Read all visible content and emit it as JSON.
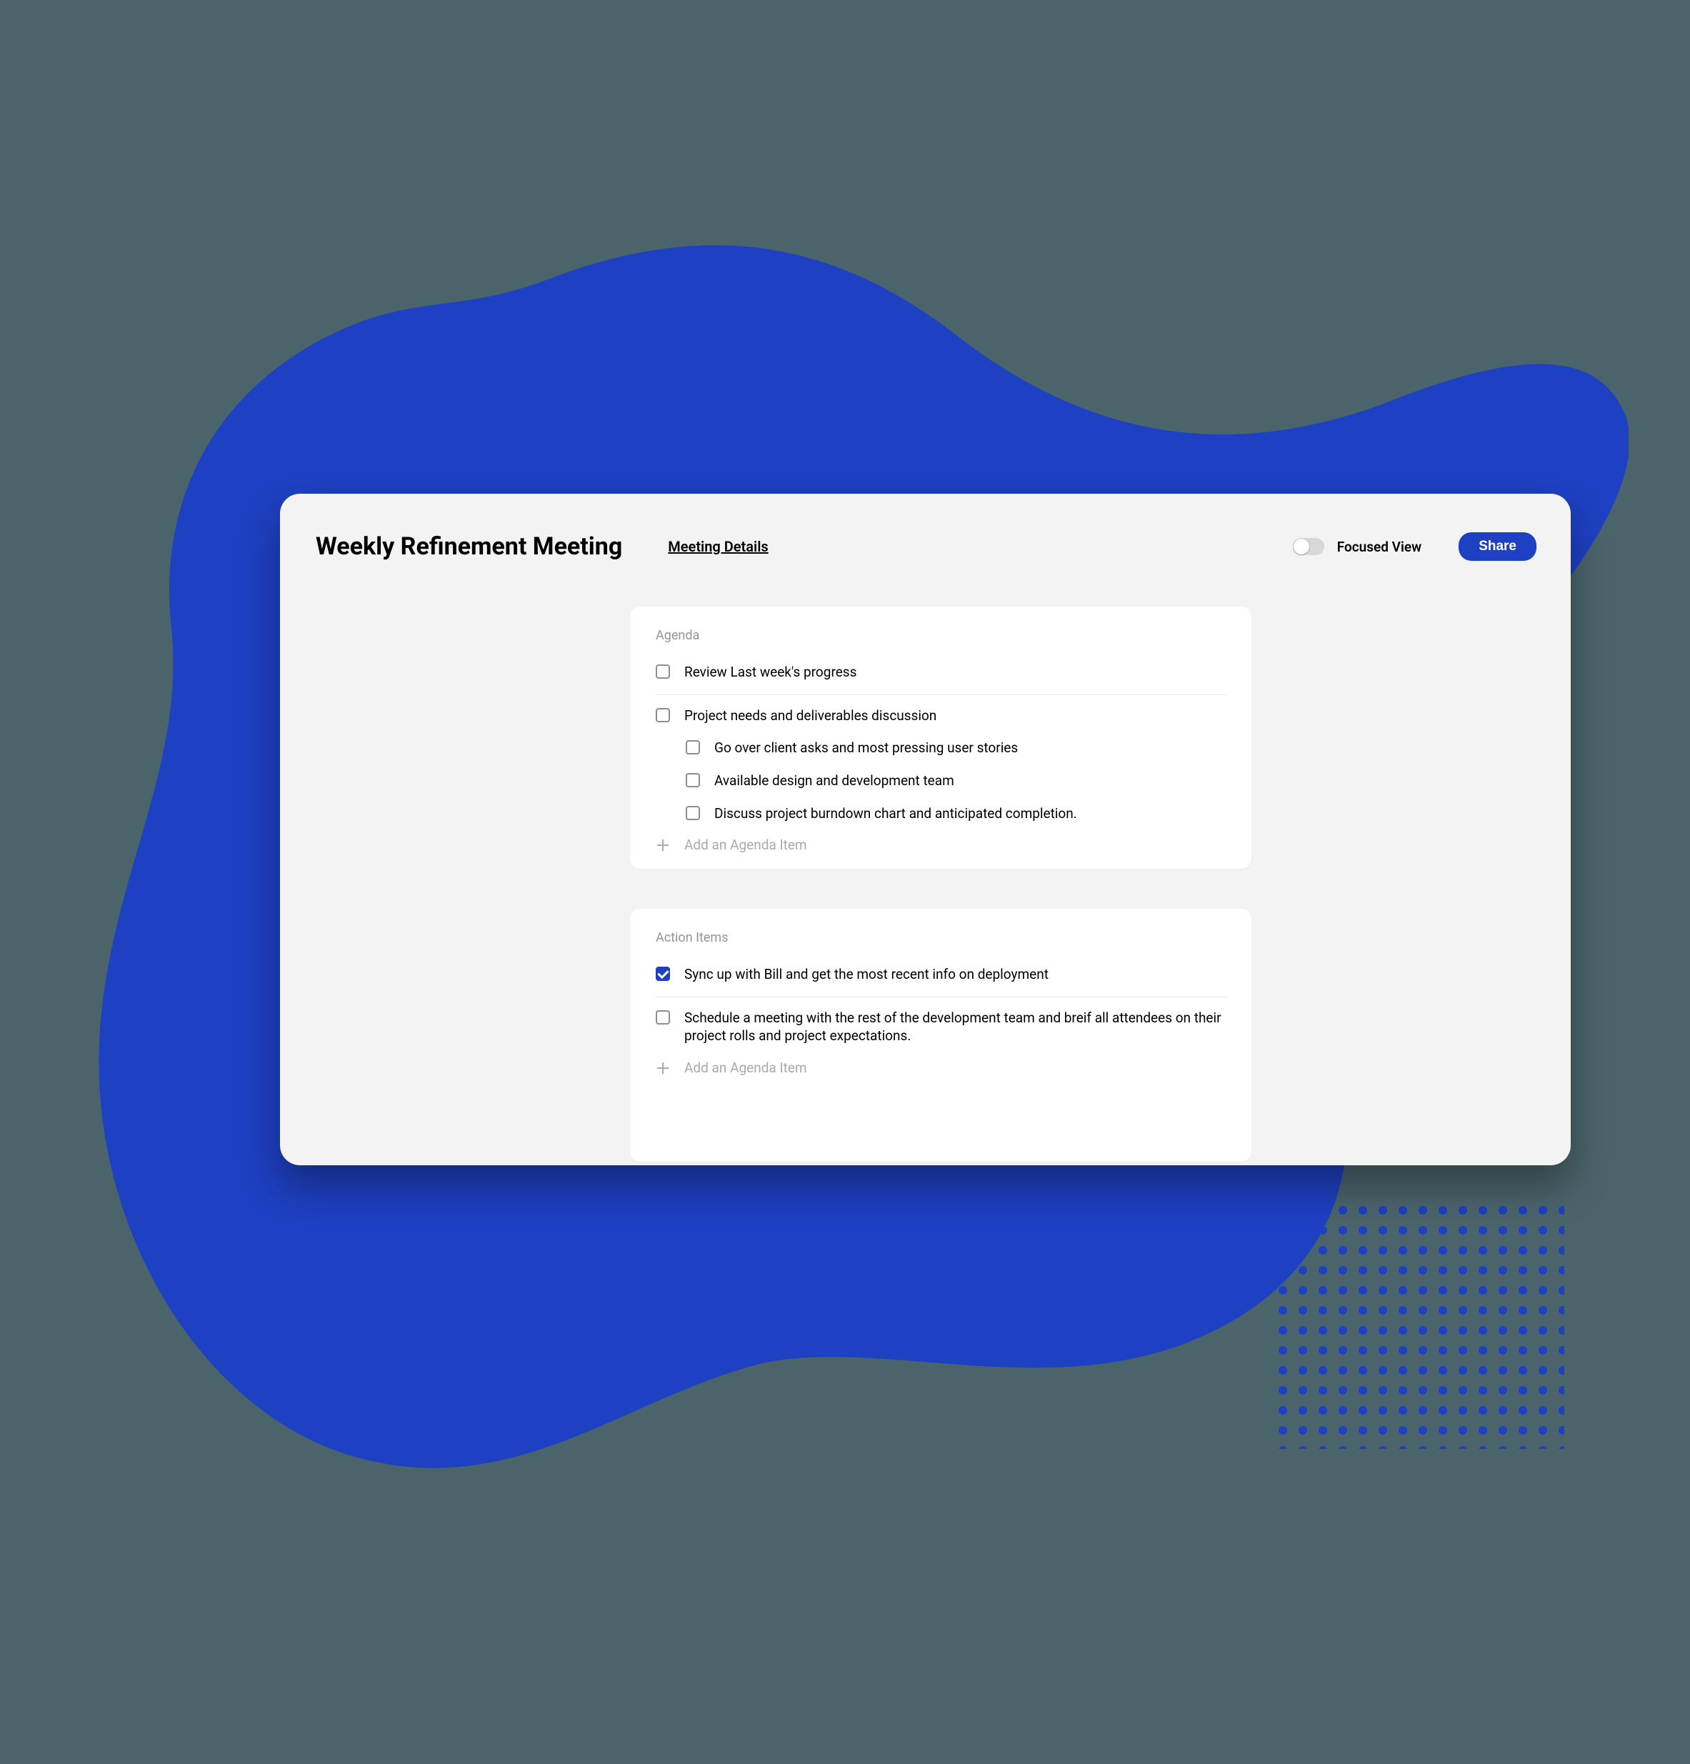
{
  "colors": {
    "accent": "#1e40c2",
    "background": "#4b646c",
    "card": "#f3f3f4",
    "panel": "#ffffff",
    "muted_text": "#929498"
  },
  "header": {
    "title": "Weekly Refinement Meeting",
    "subtitle": "Meeting Details",
    "toggle_label": "Focused View",
    "toggle_on": false,
    "share_label": "Share"
  },
  "agenda": {
    "label": "Agenda",
    "items": [
      {
        "text": "Review Last week's progress",
        "checked": false
      },
      {
        "text": "Project needs and deliverables discussion",
        "checked": false,
        "children": [
          {
            "text": "Go over client asks and most pressing user stories",
            "checked": false
          },
          {
            "text": "Available design and development team",
            "checked": false
          },
          {
            "text": "Discuss project burndown chart and anticipated completion.",
            "checked": false
          }
        ]
      }
    ],
    "add_label": "Add an Agenda Item"
  },
  "action_items": {
    "label": "Action Items",
    "items": [
      {
        "text": "Sync up with Bill and get the most recent info on deployment",
        "checked": true
      },
      {
        "text": "Schedule a meeting with the rest of the development team and breif all attendees on their project rolls and project expectations.",
        "checked": false
      }
    ],
    "add_label": "Add an Agenda Item"
  }
}
